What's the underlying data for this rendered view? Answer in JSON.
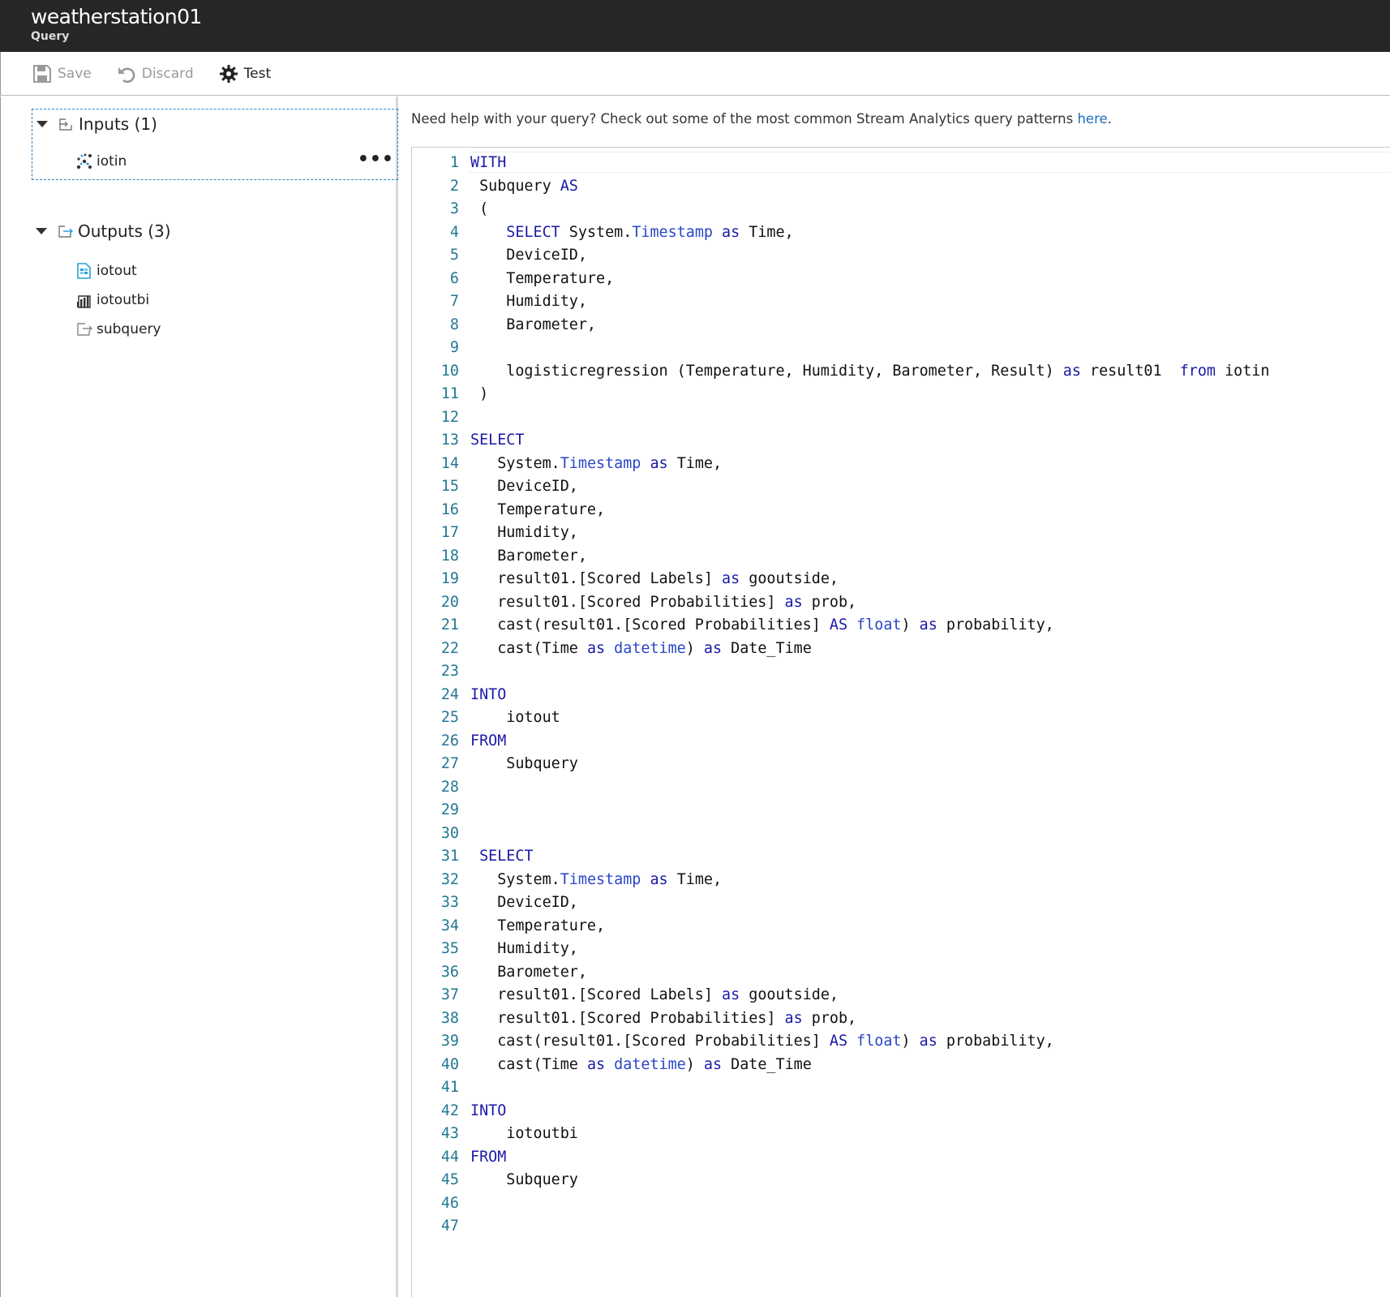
{
  "header": {
    "title": "weatherstation01",
    "subtitle": "Query"
  },
  "toolbar": {
    "save_label": "Save",
    "discard_label": "Discard",
    "test_label": "Test"
  },
  "sidebar": {
    "inputs": {
      "label": "Inputs (1)",
      "items": [
        {
          "label": "iotin",
          "icon": "iot-hub-icon"
        }
      ]
    },
    "outputs": {
      "label": "Outputs (3)",
      "items": [
        {
          "label": "iotout",
          "icon": "blob-storage-icon"
        },
        {
          "label": "iotoutbi",
          "icon": "power-bi-icon"
        },
        {
          "label": "subquery",
          "icon": "output-icon"
        }
      ]
    },
    "more_label": "•••"
  },
  "help": {
    "text": "Need help with your query? Check out some of the most common Stream Analytics query patterns ",
    "link": "here",
    "suffix": "."
  },
  "editor": {
    "lines": [
      [
        [
          "k",
          "WITH"
        ]
      ],
      [
        [
          "t",
          " Subquery "
        ],
        [
          "k",
          "AS"
        ]
      ],
      [
        [
          "t",
          " ("
        ]
      ],
      [
        [
          "t",
          "    "
        ],
        [
          "k",
          "SELECT"
        ],
        [
          "t",
          " System."
        ],
        [
          "f",
          "Timestamp"
        ],
        [
          "t",
          " "
        ],
        [
          "k",
          "as"
        ],
        [
          "t",
          " Time,"
        ]
      ],
      [
        [
          "t",
          "    DeviceID,"
        ]
      ],
      [
        [
          "t",
          "    Temperature,"
        ]
      ],
      [
        [
          "t",
          "    Humidity,"
        ]
      ],
      [
        [
          "t",
          "    Barometer,"
        ]
      ],
      [],
      [
        [
          "t",
          "    logisticregression (Temperature, Humidity, Barometer, Result) "
        ],
        [
          "k",
          "as"
        ],
        [
          "t",
          " result01  "
        ],
        [
          "k",
          "from"
        ],
        [
          "t",
          " iotin"
        ]
      ],
      [
        [
          "t",
          " )"
        ]
      ],
      [],
      [
        [
          "k",
          "SELECT"
        ]
      ],
      [
        [
          "t",
          "   System."
        ],
        [
          "f",
          "Timestamp"
        ],
        [
          "t",
          " "
        ],
        [
          "k",
          "as"
        ],
        [
          "t",
          " Time,"
        ]
      ],
      [
        [
          "t",
          "   DeviceID,"
        ]
      ],
      [
        [
          "t",
          "   Temperature,"
        ]
      ],
      [
        [
          "t",
          "   Humidity,"
        ]
      ],
      [
        [
          "t",
          "   Barometer,"
        ]
      ],
      [
        [
          "t",
          "   result01.[Scored Labels] "
        ],
        [
          "k",
          "as"
        ],
        [
          "t",
          " gooutside,"
        ]
      ],
      [
        [
          "t",
          "   result01.[Scored Probabilities] "
        ],
        [
          "k",
          "as"
        ],
        [
          "t",
          " prob,"
        ]
      ],
      [
        [
          "t",
          "   cast(result01.[Scored Probabilities] "
        ],
        [
          "k",
          "AS"
        ],
        [
          "t",
          " "
        ],
        [
          "f",
          "float"
        ],
        [
          "t",
          ") "
        ],
        [
          "k",
          "as"
        ],
        [
          "t",
          " probability,"
        ]
      ],
      [
        [
          "t",
          "   cast(Time "
        ],
        [
          "k",
          "as"
        ],
        [
          "t",
          " "
        ],
        [
          "f",
          "datetime"
        ],
        [
          "t",
          ") "
        ],
        [
          "k",
          "as"
        ],
        [
          "t",
          " Date_Time"
        ]
      ],
      [],
      [
        [
          "k",
          "INTO"
        ]
      ],
      [
        [
          "t",
          "    iotout"
        ]
      ],
      [
        [
          "k",
          "FROM"
        ]
      ],
      [
        [
          "t",
          "    Subquery"
        ]
      ],
      [],
      [],
      [],
      [
        [
          "t",
          " "
        ],
        [
          "k",
          "SELECT"
        ]
      ],
      [
        [
          "t",
          "   System."
        ],
        [
          "f",
          "Timestamp"
        ],
        [
          "t",
          " "
        ],
        [
          "k",
          "as"
        ],
        [
          "t",
          " Time,"
        ]
      ],
      [
        [
          "t",
          "   DeviceID,"
        ]
      ],
      [
        [
          "t",
          "   Temperature,"
        ]
      ],
      [
        [
          "t",
          "   Humidity,"
        ]
      ],
      [
        [
          "t",
          "   Barometer,"
        ]
      ],
      [
        [
          "t",
          "   result01.[Scored Labels] "
        ],
        [
          "k",
          "as"
        ],
        [
          "t",
          " gooutside,"
        ]
      ],
      [
        [
          "t",
          "   result01.[Scored Probabilities] "
        ],
        [
          "k",
          "as"
        ],
        [
          "t",
          " prob,"
        ]
      ],
      [
        [
          "t",
          "   cast(result01.[Scored Probabilities] "
        ],
        [
          "k",
          "AS"
        ],
        [
          "t",
          " "
        ],
        [
          "f",
          "float"
        ],
        [
          "t",
          ") "
        ],
        [
          "k",
          "as"
        ],
        [
          "t",
          " probability,"
        ]
      ],
      [
        [
          "t",
          "   cast(Time "
        ],
        [
          "k",
          "as"
        ],
        [
          "t",
          " "
        ],
        [
          "f",
          "datetime"
        ],
        [
          "t",
          ") "
        ],
        [
          "k",
          "as"
        ],
        [
          "t",
          " Date_Time"
        ]
      ],
      [],
      [
        [
          "k",
          "INTO"
        ]
      ],
      [
        [
          "t",
          "    iotoutbi"
        ]
      ],
      [
        [
          "k",
          "FROM"
        ]
      ],
      [
        [
          "t",
          "    Subquery"
        ]
      ],
      [],
      []
    ]
  }
}
